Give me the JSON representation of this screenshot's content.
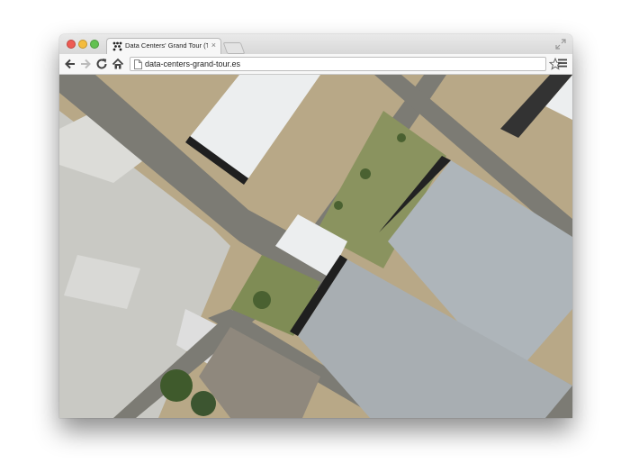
{
  "browser": {
    "tab": {
      "title": "Data Centers' Grand Tour (T",
      "close_glyph": "×"
    },
    "address": {
      "url": "data-centers-grand-tour.es"
    }
  },
  "map": {
    "type": "satellite imagery",
    "colors": {
      "road": "#7c7b74",
      "roof_gray": "#aeb5ba",
      "roof_white": "#eceeef",
      "grass": "#7f8c55",
      "soil": "#b8a887",
      "lot": "#cfcfca"
    }
  }
}
